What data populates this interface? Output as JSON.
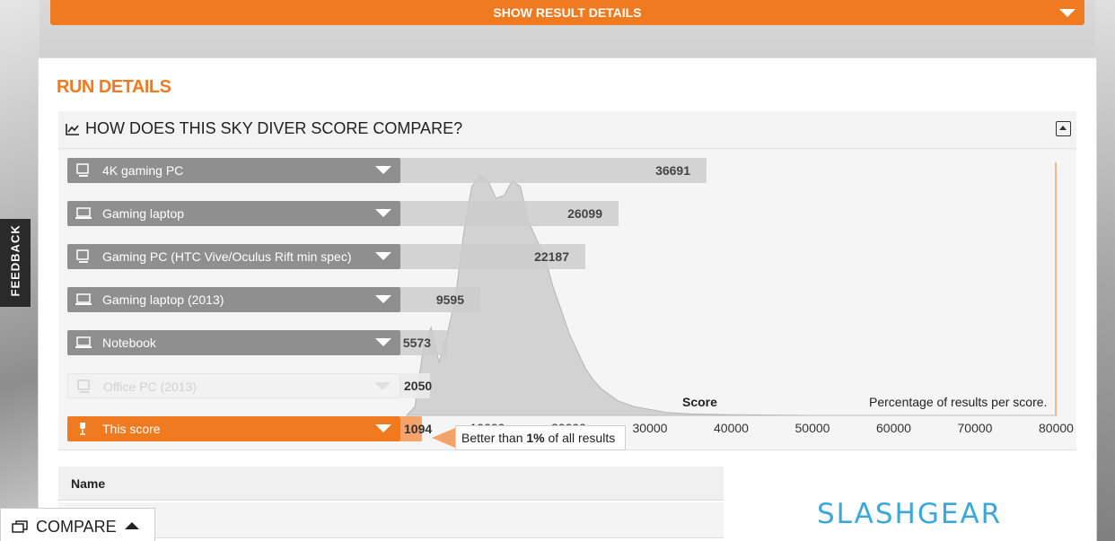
{
  "show_result_details": "SHOW RESULT DETAILS",
  "run_details_title": "RUN DETAILS",
  "compare": {
    "title": "HOW DOES THIS SKY DIVER SCORE COMPARE?",
    "rows": [
      {
        "label": "4K gaming PC",
        "score": "36691",
        "icon": "desktop-icon"
      },
      {
        "label": "Gaming laptop",
        "score": "26099",
        "icon": "laptop-icon"
      },
      {
        "label": "Gaming PC (HTC Vive/Oculus Rift min spec)",
        "score": "22187",
        "icon": "desktop-icon"
      },
      {
        "label": "Gaming laptop (2013)",
        "score": "9595",
        "icon": "laptop-icon"
      },
      {
        "label": "Notebook",
        "score": "5573",
        "icon": "laptop-icon"
      },
      {
        "label": "Office PC (2013)",
        "score": "2050",
        "icon": "desktop-icon"
      },
      {
        "label": "This score",
        "score": "1094",
        "icon": "trophy-icon"
      }
    ],
    "tooltip_prefix": "Better than ",
    "tooltip_pct": "1%",
    "tooltip_suffix": " of all results",
    "score_axis_label": "Score",
    "pct_label": "Percentage of results per score.",
    "ticks": [
      "10000",
      "20000",
      "30000",
      "40000",
      "50000",
      "60000",
      "70000",
      "80000"
    ]
  },
  "chart_data": {
    "type": "area",
    "x": [
      0,
      1000,
      2000,
      3000,
      4000,
      5000,
      6000,
      7000,
      8000,
      9000,
      10000,
      11000,
      12000,
      13000,
      14000,
      15000,
      16000,
      17000,
      18000,
      19000,
      20000,
      21000,
      22000,
      23000,
      24000,
      26000,
      28000,
      30000,
      32000,
      35000,
      40000,
      50000,
      60000,
      70000,
      80000
    ],
    "y": [
      0,
      3,
      22,
      30,
      18,
      28,
      40,
      62,
      78,
      82,
      80,
      74,
      75,
      80,
      78,
      66,
      60,
      54,
      44,
      36,
      28,
      22,
      16,
      12,
      9,
      5,
      3,
      2,
      1,
      0.5,
      0.2,
      0,
      0,
      0,
      0
    ],
    "xlabel": "Score",
    "ylabel": "Percentage of results per score.",
    "xlim": [
      0,
      80000
    ],
    "ticks": [
      10000,
      20000,
      30000,
      40000,
      50000,
      60000,
      70000,
      80000
    ]
  },
  "table": {
    "name_header": "Name"
  },
  "feedback_label": "FEEDBACK",
  "compare_button_label": "COMPARE",
  "watermark": "SLASHGEAR",
  "colors": {
    "accent": "#f07a1f",
    "bar_grey": "#8f8f8f"
  }
}
